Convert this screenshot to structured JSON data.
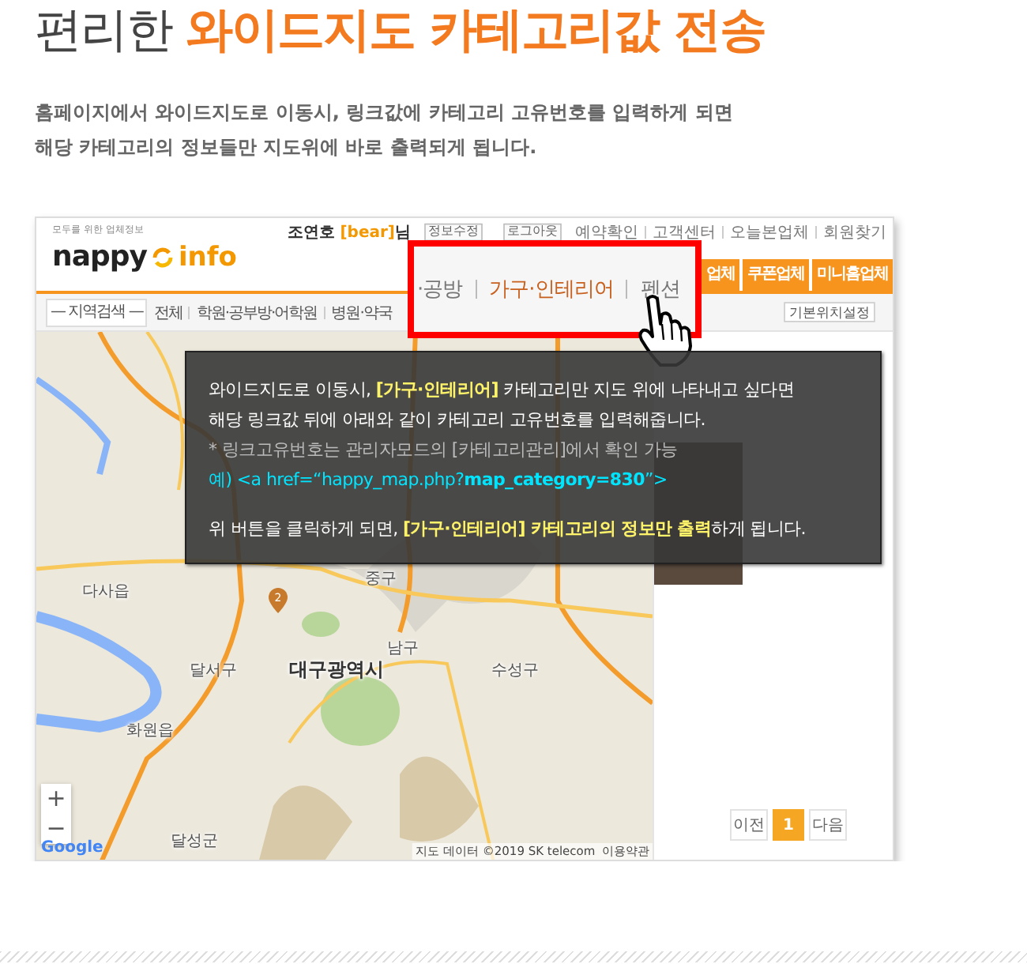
{
  "heading": "편리한 **와이드지도 카테고리값 전송**",
  "description": [
    "홈페이지에서 와이드지도로 이동시, 링크값에 카테고리 고유번호를 입력하게 되면",
    "해당 카테고리의 정보들만 지도위에 바로 출력되게 됩니다."
  ],
  "screenshot": {
    "logo": {
      "tagline": "모두를 위한 업체정보",
      "word": "nappy",
      "accent": "info"
    },
    "user": {
      "name": "조연호",
      "id": "[bear]",
      "suffix": "님"
    },
    "account_buttons": [
      "정보수정",
      "로그아웃"
    ],
    "top_links": [
      "예약확인",
      "고객센터",
      "오늘본업체",
      "회원찾기"
    ],
    "tabs": [
      "업체",
      "쿠폰업체",
      "미니홈업체"
    ],
    "region_select": "— 지역검색 —",
    "categories": [
      "전체",
      "학원·공부방·어학원",
      "병원·약국"
    ],
    "location_button": "기본위치설정",
    "map": {
      "labels": [
        {
          "kind": "place",
          "text": "중구"
        },
        {
          "kind": "place",
          "text": "다사읍"
        },
        {
          "kind": "place",
          "text": "남구"
        },
        {
          "kind": "place",
          "text": "달서구"
        },
        {
          "kind": "city",
          "text": "대구광역시"
        },
        {
          "kind": "place",
          "text": "수성구"
        },
        {
          "kind": "place",
          "text": "화원읍"
        },
        {
          "kind": "place",
          "text": "달성군"
        }
      ],
      "marker": "2",
      "zoom_in": "+",
      "zoom_out": "−",
      "brand": "Google",
      "attribution": "지도 데이터 ©2019 SK telecom",
      "terms": "이용약관"
    },
    "pagination": [
      {
        "label": "이전",
        "selected": false
      },
      {
        "label": "1",
        "selected": true
      },
      {
        "label": "다음",
        "selected": false
      }
    ]
  },
  "callout": {
    "categories": [
      {
        "label": "·공방",
        "selected": false
      },
      {
        "label": "가구·인테리어",
        "selected": true
      },
      {
        "label": "펜션",
        "selected": false
      }
    ]
  },
  "tooltip": {
    "lines": [
      {
        "kind": "text",
        "text": "와이드지도로 이동시, **[가구·인테리어]** 카테고리만 지도 위에 나타내고 싶다면"
      },
      {
        "kind": "text",
        "text": "해당 링크값 뒤에 아래와 같이 카테고리 고유번호를 입력해줍니다."
      },
      {
        "kind": "note",
        "text": "* 링크고유번호는 관리자모드의 [카테고리관리]에서 확인 가능"
      },
      {
        "kind": "code",
        "text": "예) <a href=“happy_map.php?**map_category=830**”>"
      },
      {
        "kind": "gap"
      },
      {
        "kind": "text",
        "text": "위 버튼을 클릭하게 되면, **[가구·인테리어] 카테고리의 정보만 출력**하게 됩니다."
      }
    ]
  }
}
